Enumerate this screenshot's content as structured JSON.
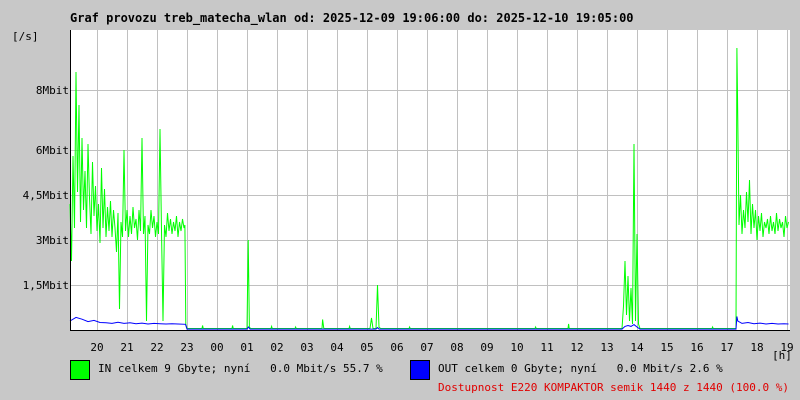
{
  "chart_data": {
    "type": "line",
    "title": "Graf provozu treb_matecha_wlan od: 2025-12-09 19:06:00 do: 2025-12-10 19:05:00",
    "ylabel": "[/s]",
    "xlabel": "[h]",
    "ylim": [
      0,
      10
    ],
    "y_unit": "Mbit/s",
    "y_ticks": [
      {
        "value": 1.5,
        "label": "1,5Mbit"
      },
      {
        "value": 3,
        "label": "3Mbit"
      },
      {
        "value": 4.5,
        "label": "4,5Mbit"
      },
      {
        "value": 6,
        "label": "6Mbit"
      },
      {
        "value": 8,
        "label": "8Mbit"
      }
    ],
    "x_range": [
      19.1,
      43.1
    ],
    "x_unit": "hours since 2025-12-09 00:00",
    "x_ticks": [
      {
        "value": 20,
        "label": "20"
      },
      {
        "value": 21,
        "label": "21"
      },
      {
        "value": 22,
        "label": "22"
      },
      {
        "value": 23,
        "label": "23"
      },
      {
        "value": 24,
        "label": "00"
      },
      {
        "value": 25,
        "label": "01"
      },
      {
        "value": 26,
        "label": "02"
      },
      {
        "value": 27,
        "label": "03"
      },
      {
        "value": 28,
        "label": "04"
      },
      {
        "value": 29,
        "label": "05"
      },
      {
        "value": 30,
        "label": "06"
      },
      {
        "value": 31,
        "label": "07"
      },
      {
        "value": 32,
        "label": "08"
      },
      {
        "value": 33,
        "label": "09"
      },
      {
        "value": 34,
        "label": "10"
      },
      {
        "value": 35,
        "label": "11"
      },
      {
        "value": 36,
        "label": "12"
      },
      {
        "value": 37,
        "label": "13"
      },
      {
        "value": 38,
        "label": "14"
      },
      {
        "value": 39,
        "label": "15"
      },
      {
        "value": 40,
        "label": "16"
      },
      {
        "value": 41,
        "label": "17"
      },
      {
        "value": 42,
        "label": "18"
      },
      {
        "value": 43,
        "label": "19"
      }
    ],
    "grid": true,
    "series": [
      {
        "name": "IN",
        "color": "#00ff00",
        "points": [
          [
            19.1,
            4.2
          ],
          [
            19.15,
            2.3
          ],
          [
            19.2,
            5.8
          ],
          [
            19.25,
            3.4
          ],
          [
            19.3,
            8.6
          ],
          [
            19.35,
            4.6
          ],
          [
            19.4,
            7.5
          ],
          [
            19.45,
            3.6
          ],
          [
            19.5,
            6.4
          ],
          [
            19.55,
            4.0
          ],
          [
            19.6,
            5.3
          ],
          [
            19.65,
            3.4
          ],
          [
            19.7,
            6.2
          ],
          [
            19.75,
            4.4
          ],
          [
            19.8,
            3.2
          ],
          [
            19.85,
            5.6
          ],
          [
            19.9,
            3.8
          ],
          [
            19.95,
            4.8
          ],
          [
            20.0,
            3.3
          ],
          [
            20.05,
            4.2
          ],
          [
            20.1,
            2.9
          ],
          [
            20.15,
            5.4
          ],
          [
            20.2,
            3.4
          ],
          [
            20.25,
            4.7
          ],
          [
            20.3,
            3.1
          ],
          [
            20.35,
            4.1
          ],
          [
            20.4,
            3.3
          ],
          [
            20.45,
            4.3
          ],
          [
            20.5,
            3.1
          ],
          [
            20.55,
            4.0
          ],
          [
            20.6,
            3.4
          ],
          [
            20.65,
            2.6
          ],
          [
            20.7,
            3.9
          ],
          [
            20.75,
            0.7
          ],
          [
            20.8,
            3.6
          ],
          [
            20.85,
            3.1
          ],
          [
            20.9,
            6.0
          ],
          [
            20.95,
            3.3
          ],
          [
            21.0,
            4.0
          ],
          [
            21.05,
            3.1
          ],
          [
            21.1,
            3.8
          ],
          [
            21.15,
            3.2
          ],
          [
            21.2,
            4.1
          ],
          [
            21.25,
            3.4
          ],
          [
            21.3,
            3.7
          ],
          [
            21.35,
            3.0
          ],
          [
            21.4,
            4.0
          ],
          [
            21.45,
            3.3
          ],
          [
            21.5,
            6.4
          ],
          [
            21.55,
            3.2
          ],
          [
            21.6,
            3.8
          ],
          [
            21.65,
            0.3
          ],
          [
            21.7,
            3.5
          ],
          [
            21.75,
            3.2
          ],
          [
            21.8,
            4.0
          ],
          [
            21.85,
            3.4
          ],
          [
            21.9,
            3.8
          ],
          [
            21.95,
            3.1
          ],
          [
            22.0,
            3.6
          ],
          [
            22.05,
            3.2
          ],
          [
            22.1,
            6.7
          ],
          [
            22.15,
            3.3
          ],
          [
            22.2,
            0.3
          ],
          [
            22.25,
            3.5
          ],
          [
            22.3,
            3.1
          ],
          [
            22.35,
            3.9
          ],
          [
            22.4,
            3.3
          ],
          [
            22.45,
            3.7
          ],
          [
            22.5,
            3.2
          ],
          [
            22.55,
            3.6
          ],
          [
            22.6,
            3.3
          ],
          [
            22.65,
            3.8
          ],
          [
            22.7,
            3.1
          ],
          [
            22.75,
            3.6
          ],
          [
            22.8,
            3.3
          ],
          [
            22.85,
            3.7
          ],
          [
            22.9,
            3.4
          ],
          [
            22.93,
            3.5
          ],
          [
            22.96,
            0.2
          ],
          [
            23.0,
            0.05
          ],
          [
            23.5,
            0.05
          ],
          [
            23.52,
            0.15
          ],
          [
            23.54,
            0.05
          ],
          [
            24.5,
            0.05
          ],
          [
            24.52,
            0.15
          ],
          [
            24.54,
            0.05
          ],
          [
            25.0,
            0.05
          ],
          [
            25.04,
            3.0
          ],
          [
            25.08,
            0.1
          ],
          [
            25.12,
            0.05
          ],
          [
            25.8,
            0.05
          ],
          [
            25.82,
            0.12
          ],
          [
            25.84,
            0.05
          ],
          [
            26.6,
            0.05
          ],
          [
            26.62,
            0.1
          ],
          [
            26.64,
            0.05
          ],
          [
            27.5,
            0.05
          ],
          [
            27.52,
            0.35
          ],
          [
            27.56,
            0.05
          ],
          [
            28.0,
            0.05
          ],
          [
            28.4,
            0.05
          ],
          [
            28.42,
            0.12
          ],
          [
            28.44,
            0.05
          ],
          [
            29.1,
            0.05
          ],
          [
            29.15,
            0.4
          ],
          [
            29.2,
            0.05
          ],
          [
            29.3,
            0.05
          ],
          [
            29.35,
            1.5
          ],
          [
            29.4,
            0.1
          ],
          [
            29.45,
            0.05
          ],
          [
            30.4,
            0.05
          ],
          [
            30.42,
            0.1
          ],
          [
            30.44,
            0.05
          ],
          [
            32.0,
            0.05
          ],
          [
            33.0,
            0.05
          ],
          [
            34.0,
            0.05
          ],
          [
            34.6,
            0.05
          ],
          [
            34.62,
            0.1
          ],
          [
            34.64,
            0.05
          ],
          [
            35.7,
            0.05
          ],
          [
            35.72,
            0.2
          ],
          [
            35.74,
            0.05
          ],
          [
            37.0,
            0.05
          ],
          [
            37.5,
            0.05
          ],
          [
            37.55,
            0.8
          ],
          [
            37.6,
            2.3
          ],
          [
            37.65,
            0.5
          ],
          [
            37.7,
            1.8
          ],
          [
            37.75,
            0.3
          ],
          [
            37.8,
            1.4
          ],
          [
            37.85,
            0.2
          ],
          [
            37.9,
            6.2
          ],
          [
            37.95,
            0.3
          ],
          [
            38.0,
            3.2
          ],
          [
            38.05,
            0.2
          ],
          [
            38.1,
            0.05
          ],
          [
            39.0,
            0.05
          ],
          [
            40.0,
            0.05
          ],
          [
            40.5,
            0.05
          ],
          [
            40.52,
            0.1
          ],
          [
            40.54,
            0.05
          ],
          [
            41.0,
            0.05
          ],
          [
            41.3,
            0.05
          ],
          [
            41.33,
            9.4
          ],
          [
            41.36,
            7.0
          ],
          [
            41.4,
            3.5
          ],
          [
            41.45,
            4.5
          ],
          [
            41.5,
            3.2
          ],
          [
            41.55,
            4.0
          ],
          [
            41.6,
            3.4
          ],
          [
            41.65,
            4.6
          ],
          [
            41.7,
            3.6
          ],
          [
            41.75,
            5.0
          ],
          [
            41.8,
            3.2
          ],
          [
            41.85,
            4.2
          ],
          [
            41.9,
            3.4
          ],
          [
            41.95,
            4.0
          ],
          [
            42.0,
            3.0
          ],
          [
            42.05,
            3.8
          ],
          [
            42.1,
            3.3
          ],
          [
            42.15,
            3.9
          ],
          [
            42.2,
            3.1
          ],
          [
            42.25,
            3.6
          ],
          [
            42.3,
            3.4
          ],
          [
            42.35,
            3.7
          ],
          [
            42.4,
            3.2
          ],
          [
            42.45,
            3.8
          ],
          [
            42.5,
            3.3
          ],
          [
            42.55,
            3.6
          ],
          [
            42.6,
            3.2
          ],
          [
            42.65,
            3.9
          ],
          [
            42.7,
            3.3
          ],
          [
            42.75,
            3.7
          ],
          [
            42.8,
            3.4
          ],
          [
            42.85,
            3.6
          ],
          [
            42.9,
            3.1
          ],
          [
            42.95,
            3.8
          ],
          [
            43.0,
            3.4
          ],
          [
            43.05,
            3.6
          ]
        ]
      },
      {
        "name": "OUT",
        "color": "#0000ff",
        "points": [
          [
            19.1,
            0.3
          ],
          [
            19.3,
            0.42
          ],
          [
            19.5,
            0.36
          ],
          [
            19.7,
            0.28
          ],
          [
            19.9,
            0.32
          ],
          [
            20.1,
            0.25
          ],
          [
            20.3,
            0.24
          ],
          [
            20.5,
            0.22
          ],
          [
            20.7,
            0.26
          ],
          [
            20.9,
            0.22
          ],
          [
            21.1,
            0.24
          ],
          [
            21.3,
            0.21
          ],
          [
            21.5,
            0.23
          ],
          [
            21.7,
            0.2
          ],
          [
            21.9,
            0.22
          ],
          [
            22.1,
            0.21
          ],
          [
            22.3,
            0.2
          ],
          [
            22.5,
            0.21
          ],
          [
            22.7,
            0.2
          ],
          [
            22.95,
            0.19
          ],
          [
            23.0,
            0.03
          ],
          [
            25.0,
            0.03
          ],
          [
            25.05,
            0.1
          ],
          [
            25.1,
            0.03
          ],
          [
            29.3,
            0.03
          ],
          [
            29.35,
            0.08
          ],
          [
            29.4,
            0.03
          ],
          [
            37.5,
            0.03
          ],
          [
            37.6,
            0.12
          ],
          [
            37.7,
            0.15
          ],
          [
            37.8,
            0.12
          ],
          [
            37.9,
            0.18
          ],
          [
            38.0,
            0.1
          ],
          [
            38.1,
            0.03
          ],
          [
            41.3,
            0.03
          ],
          [
            41.33,
            0.45
          ],
          [
            41.36,
            0.3
          ],
          [
            41.5,
            0.22
          ],
          [
            41.7,
            0.25
          ],
          [
            41.9,
            0.21
          ],
          [
            42.1,
            0.23
          ],
          [
            42.3,
            0.2
          ],
          [
            42.5,
            0.22
          ],
          [
            42.7,
            0.2
          ],
          [
            42.9,
            0.21
          ],
          [
            43.05,
            0.2
          ]
        ]
      }
    ],
    "legend": [
      {
        "color": "#00ff00",
        "text": "IN celkem 9 Gbyte; nyní   0.0 Mbit/s 55.7 %"
      },
      {
        "color": "#0000ff",
        "text": "OUT celkem 0 Gbyte; nyní   0.0 Mbit/s 2.6 %"
      }
    ],
    "status": "Dostupnost E220 KOMPAKTOR semik 1440 z 1440 (100.0 %)"
  }
}
